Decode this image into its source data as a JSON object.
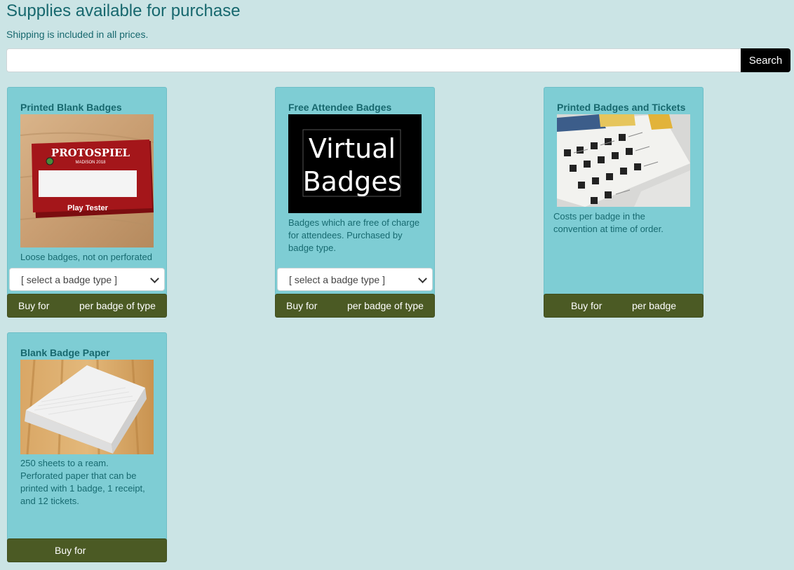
{
  "header": {
    "title": "Supplies available for purchase",
    "subtitle": "Shipping is included in all prices."
  },
  "search": {
    "value": "",
    "placeholder": "",
    "button_label": "Search"
  },
  "products": [
    {
      "title": "Printed Blank Badges",
      "description": "Loose badges, not on perforated",
      "image": {
        "brand": "PROTOSPIEL",
        "subtitle": "MADISON 2018",
        "label": "Play Tester"
      },
      "select_value": "[ select a badge type ]",
      "buy_prefix": "Buy for",
      "buy_suffix": "per badge of type"
    },
    {
      "title": "Free Attendee Badges",
      "description": "Badges which are free of charge for attendees. Purchased by badge type.",
      "image": {
        "line1": "Virtual",
        "line2": "Badges"
      },
      "select_value": "[ select a badge type ]",
      "buy_prefix": "Buy for",
      "buy_suffix": "per badge of type"
    },
    {
      "title": "Printed Badges and Tickets",
      "description": "Costs per badge in the convention at time of order.",
      "buy_prefix": "Buy for",
      "buy_suffix": "per badge"
    },
    {
      "title": "Blank Badge Paper",
      "description": "250 sheets to a ream. Perforated paper that can be printed with 1 badge, 1 receipt, and 12 tickets.",
      "buy_prefix": "Buy for"
    }
  ],
  "colors": {
    "background": "#cbe4e5",
    "card": "#7ecdd4",
    "text": "#17686e",
    "buy_button": "#4b5a24",
    "search_button": "#000000"
  }
}
